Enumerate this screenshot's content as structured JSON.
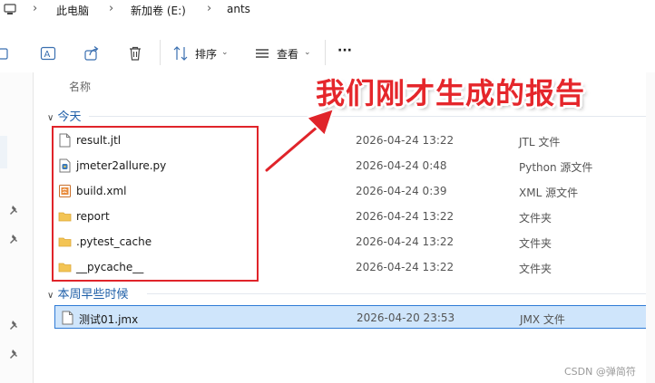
{
  "breadcrumb": {
    "items": [
      "此电脑",
      "新加卷 (E:)",
      "ants"
    ]
  },
  "toolbar": {
    "sort_label": "排序",
    "view_label": "查看",
    "more_label": "···"
  },
  "header": {
    "name_col": "名称"
  },
  "groups": {
    "today": "今天",
    "earlier_this_week": "本周早些时候"
  },
  "files": [
    {
      "name": "result.jtl",
      "date": "2026-04-24 13:22",
      "type": "JTL 文件",
      "icon": "document-icon"
    },
    {
      "name": "jmeter2allure.py",
      "date": "2026-04-24 0:48",
      "type": "Python 源文件",
      "icon": "python-file-icon"
    },
    {
      "name": "build.xml",
      "date": "2026-04-24 0:39",
      "type": "XML 源文件",
      "icon": "xml-file-icon"
    },
    {
      "name": "report",
      "date": "2026-04-24 13:22",
      "type": "文件夹",
      "icon": "folder-icon"
    },
    {
      "name": ".pytest_cache",
      "date": "2026-04-24 13:22",
      "type": "文件夹",
      "icon": "folder-icon"
    },
    {
      "name": "__pycache__",
      "date": "2026-04-24 13:22",
      "type": "文件夹",
      "icon": "folder-icon"
    },
    {
      "name": "测试01.jmx",
      "date": "2026-04-20 23:53",
      "type": "JMX 文件",
      "icon": "document-icon",
      "selected": true
    }
  ],
  "annotation": {
    "text": "我们刚才生成的报告",
    "color": "#e5262b"
  },
  "watermark": "CSDN @弹简符",
  "colors": {
    "accent": "#2f7bd6",
    "selection": "#cfe5fb",
    "folder": "#f3c454",
    "group_text": "#1f5fa8"
  }
}
